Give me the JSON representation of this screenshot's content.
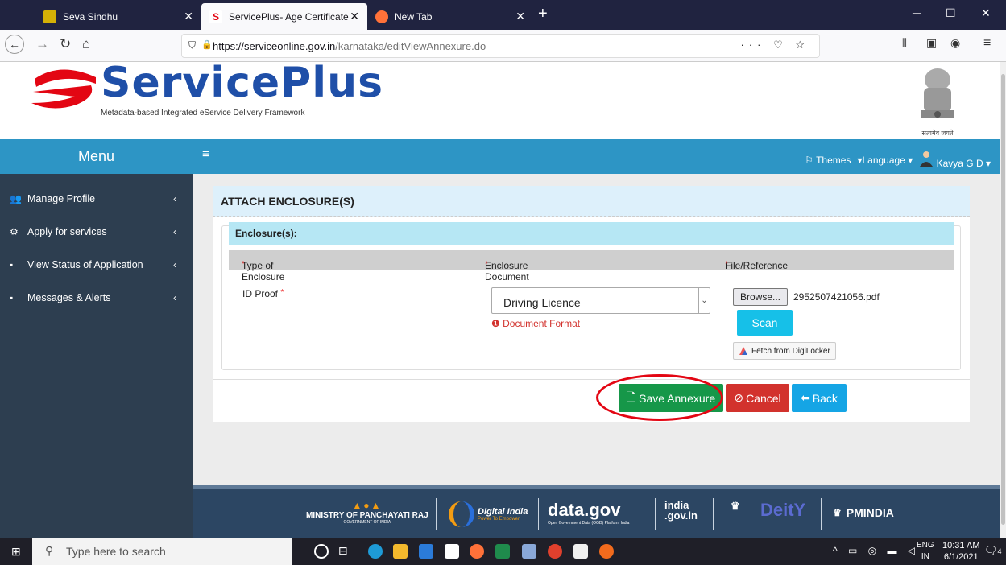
{
  "browser": {
    "tabs": [
      {
        "title": "Seva Sindhu",
        "active": false
      },
      {
        "title": "ServicePlus- Age Certificate",
        "active": true
      },
      {
        "title": "New Tab",
        "active": false
      }
    ],
    "url_host": "https://serviceonline.gov.in",
    "url_path": "/karnataka/editViewAnnexure.do"
  },
  "header": {
    "logo_text": "ServicePlus",
    "logo_tagline": "Metadata-based Integrated eService Delivery Framework",
    "emblem_caption": "सत्यमेव जयते"
  },
  "sidebar": {
    "menu_title": "Menu",
    "items": [
      {
        "label": "Manage Profile"
      },
      {
        "label": "Apply for services"
      },
      {
        "label": "View Status of Application"
      },
      {
        "label": "Messages & Alerts"
      }
    ]
  },
  "topnav": {
    "themes": "Themes",
    "language": "Language",
    "user": "Kavya G D"
  },
  "form": {
    "title": "ATTACH ENCLOSURE(S)",
    "panel_title": "Enclosure(s):",
    "col_type": "Type of Enclosure",
    "col_doc": "Enclosure Document",
    "col_file": "File/Reference",
    "required_mark": "*",
    "row_label": "ID Proof",
    "selected_document": "Driving Licence",
    "doc_format_link": "Document Format",
    "browse_label": "Browse...",
    "file_name": "2952507421056.pdf",
    "scan_label": "Scan",
    "digilocker_label": "Fetch from DigiLocker"
  },
  "buttons": {
    "save": "Save Annexure",
    "cancel": "Cancel",
    "back": "Back"
  },
  "footer": {
    "ministry": "MINISTRY OF PANCHAYATI RAJ",
    "ministry_sub": "GOVERNMENT OF INDIA",
    "digital_india": "Digital India",
    "digital_india_sub": "Power To Empower",
    "datagov": "data.gov",
    "datagov_sub": "Open Government Data (OGD) Platform India",
    "indiagov": "india .gov.in",
    "deity": "DeitY",
    "pmindia": "PMINDIA"
  },
  "taskbar": {
    "search_placeholder": "Type here to search",
    "lang": "ENG",
    "region": "IN",
    "time": "10:31 AM",
    "date": "6/1/2021",
    "notif_count": "4"
  },
  "colors": {
    "sidebar": "#2d3e50",
    "topnav": "#2d95c5",
    "save": "#169749",
    "cancel": "#d2322d",
    "back": "#15a5e5",
    "highlight_oval": "#e30613"
  }
}
